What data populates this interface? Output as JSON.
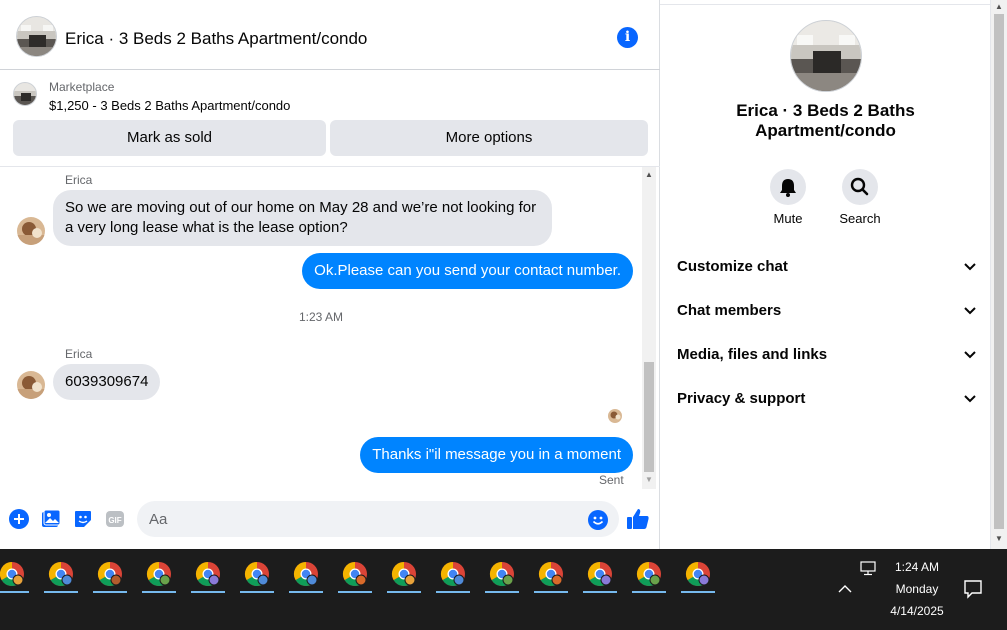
{
  "chat_header": {
    "title": "Erica · 3 Beds 2 Baths Apartment/condo"
  },
  "marketplace": {
    "label": "Marketplace",
    "listing": "$1,250 - 3 Beds 2 Baths Apartment/condo",
    "mark_sold": "Mark as sold",
    "more_options": "More options"
  },
  "thread": {
    "msg1": {
      "sender": "Erica",
      "text": "So we are moving out of our home on May 28 and we’re not looking for a very long lease what is the lease option?"
    },
    "msg2": {
      "text": "Ok.Please can you send your contact number."
    },
    "timestamp": "1:23 AM",
    "msg3": {
      "sender": "Erica",
      "text": "6039309674"
    },
    "msg4": {
      "text": "Thanks i\"il message you in a moment"
    },
    "status": "Sent"
  },
  "composer": {
    "placeholder": "Aa"
  },
  "panel": {
    "title": "Erica · 3 Beds 2 Baths Apartment/condo",
    "mute": "Mute",
    "search": "Search",
    "sections": [
      "Customize chat",
      "Chat members",
      "Media, files and links",
      "Privacy & support"
    ]
  },
  "taskbar": {
    "apps": [
      "chrome-icon",
      "chrome-icon",
      "chrome-icon",
      "chrome-icon",
      "chrome-icon",
      "chrome-icon",
      "chrome-icon",
      "chrome-icon",
      "chrome-icon",
      "chrome-icon",
      "chrome-icon",
      "chrome-icon",
      "chrome-icon",
      "chrome-icon",
      "chrome-icon"
    ],
    "time": "1:24 AM",
    "day": "Monday",
    "date": "4/14/2025"
  },
  "colors": {
    "messenger_blue": "#0084ff",
    "accent": "#0866ff",
    "bubble_gray": "#e4e6eb",
    "taskbar": "#1c1c1c"
  }
}
